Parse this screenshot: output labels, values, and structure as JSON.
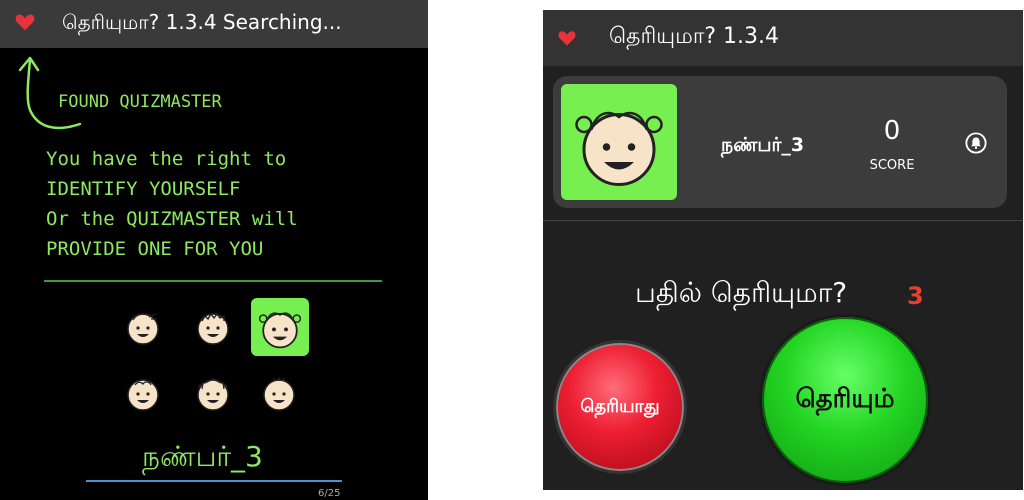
{
  "left": {
    "title": "தெரியுமா? 1.3.4  Searching...",
    "found_text": "FOUND QUIZMASTER",
    "instructions": [
      "You have  the  right to",
      " IDENTIFY YOURSELF",
      "Or the QUIZMASTER will",
      "PROVIDE ONE FOR YOU"
    ],
    "username": "நண்பர்_3",
    "pager": "6/25"
  },
  "right": {
    "title": "தெரியுமா? 1.3.4",
    "player_name": "நண்பர்_3",
    "score_value": "0",
    "score_label": "SCORE",
    "question": "பதில் தெரியுமா?",
    "countdown": "3",
    "no_button": "தெரியாது",
    "yes_button": "தெரியும்"
  },
  "colors": {
    "accent_green": "#78ef50",
    "chalk_green": "#8ee860",
    "heart_red": "#e8333b",
    "countdown_red": "#e8402e",
    "button_red": "#ee1f33",
    "button_green": "#22d422"
  },
  "icons": [
    "heart-icon",
    "arrow-icon",
    "avatar-face",
    "bell-icon"
  ]
}
